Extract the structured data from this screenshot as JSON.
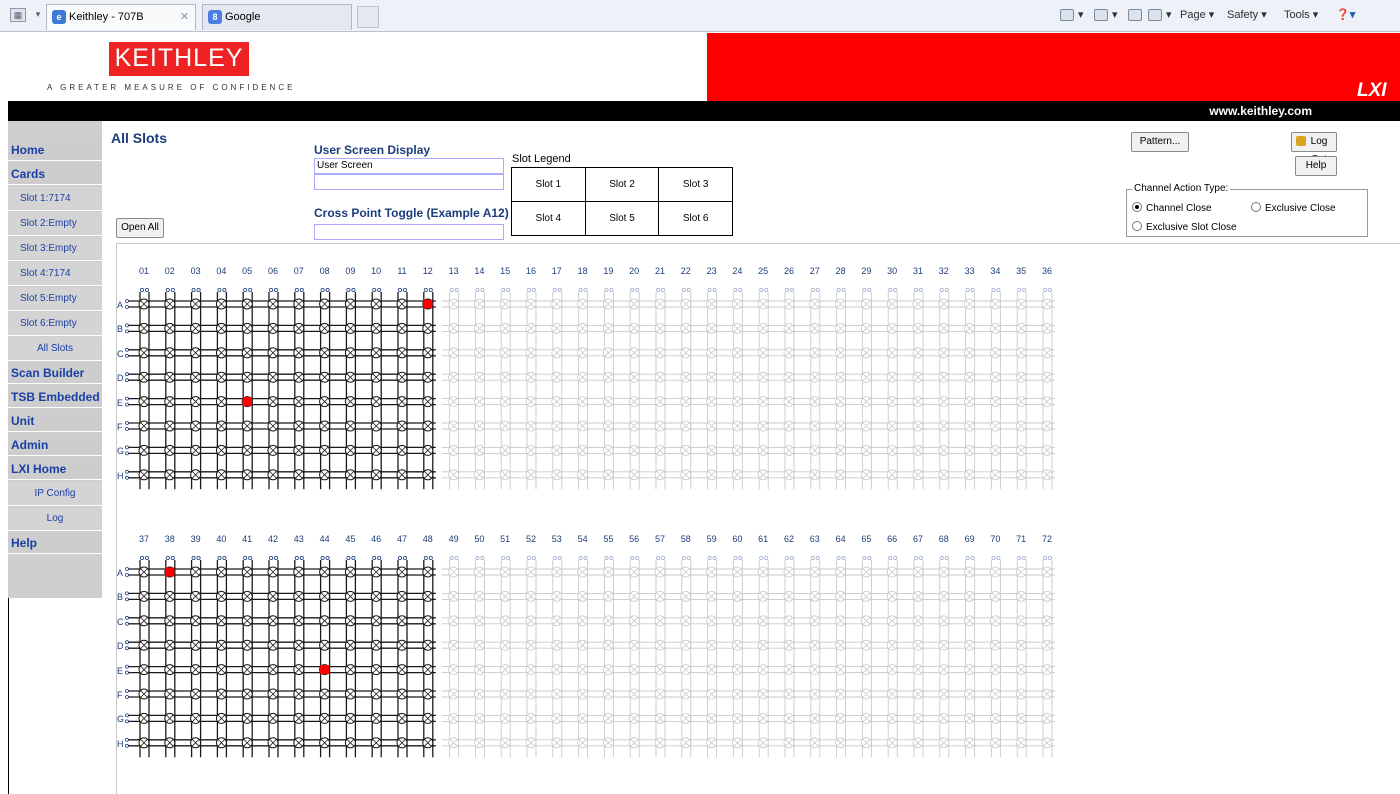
{
  "browser": {
    "tabs": [
      {
        "label": "Keithley - 707B",
        "icon": "ie-page-icon",
        "active": true
      },
      {
        "label": "Google",
        "icon": "google-icon",
        "active": false
      }
    ],
    "commands": [
      "Page ▾",
      "Safety ▾",
      "Tools ▾"
    ]
  },
  "header": {
    "brand": "KEITHLEY",
    "tagline": "A GREATER MEASURE OF CONFIDENCE",
    "lxi_logo": "LXI",
    "website": "www.keithley.com",
    "colors": {
      "brand_red": "#ff0000",
      "bar": "#000000"
    }
  },
  "sidebar": {
    "items": [
      {
        "label": "Home",
        "type": "main"
      },
      {
        "label": "Cards",
        "type": "main"
      },
      {
        "label": "Slot 1:7174",
        "type": "sub"
      },
      {
        "label": "Slot 2:Empty",
        "type": "sub"
      },
      {
        "label": "Slot 3:Empty",
        "type": "sub"
      },
      {
        "label": "Slot 4:7174",
        "type": "sub"
      },
      {
        "label": "Slot 5:Empty",
        "type": "sub"
      },
      {
        "label": "Slot 6:Empty",
        "type": "sub"
      },
      {
        "label": "All Slots",
        "type": "sub"
      },
      {
        "label": "Scan Builder",
        "type": "main"
      },
      {
        "label": "TSB Embedded",
        "type": "main"
      },
      {
        "label": "Unit",
        "type": "main"
      },
      {
        "label": "Admin",
        "type": "main"
      },
      {
        "label": "LXI Home",
        "type": "main"
      },
      {
        "label": "IP Config",
        "type": "sub"
      },
      {
        "label": "Log",
        "type": "sub"
      },
      {
        "label": "Help",
        "type": "main"
      }
    ]
  },
  "main": {
    "title": "All Slots",
    "open_all_label": "Open All",
    "user_screen": {
      "label": "User Screen Display",
      "line1": "User Screen",
      "line2": ""
    },
    "cross_point": {
      "label": "Cross Point Toggle (Example A12)",
      "value": ""
    },
    "slot_legend": {
      "caption": "Slot Legend",
      "slots": [
        "Slot 1",
        "Slot 2",
        "Slot 3",
        "Slot 4",
        "Slot 5",
        "Slot 6"
      ]
    },
    "pattern_label": "Pattern...",
    "logout_label": "Log Out",
    "help_label": "Help",
    "channel_action": {
      "legend": "Channel Action Type:",
      "options": [
        {
          "label": "Channel Close",
          "selected": true
        },
        {
          "label": "Exclusive Close",
          "selected": false
        },
        {
          "label": "Exclusive Slot Close",
          "selected": false
        }
      ]
    }
  },
  "matrix": {
    "rows": [
      "A",
      "B",
      "C",
      "D",
      "E",
      "F",
      "G",
      "H"
    ],
    "banks": [
      {
        "columns": [
          "01",
          "02",
          "03",
          "04",
          "05",
          "06",
          "07",
          "08",
          "09",
          "10",
          "11",
          "12",
          "13",
          "14",
          "15",
          "16",
          "17",
          "18",
          "19",
          "20",
          "21",
          "22",
          "23",
          "24",
          "25",
          "26",
          "27",
          "28",
          "29",
          "30",
          "31",
          "32",
          "33",
          "34",
          "35",
          "36"
        ],
        "active_columns": 12,
        "closed": [
          "A12",
          "E05"
        ]
      },
      {
        "columns": [
          "37",
          "38",
          "39",
          "40",
          "41",
          "42",
          "43",
          "44",
          "45",
          "46",
          "47",
          "48",
          "49",
          "50",
          "51",
          "52",
          "53",
          "54",
          "55",
          "56",
          "57",
          "58",
          "59",
          "60",
          "61",
          "62",
          "63",
          "64",
          "65",
          "66",
          "67",
          "68",
          "69",
          "70",
          "71",
          "72"
        ],
        "active_columns": 12,
        "closed": [
          "A38",
          "E44"
        ]
      }
    ],
    "colors": {
      "active": "#1a1a1a",
      "inactive": "#c9c9c9",
      "closed": "#ff0000"
    }
  }
}
